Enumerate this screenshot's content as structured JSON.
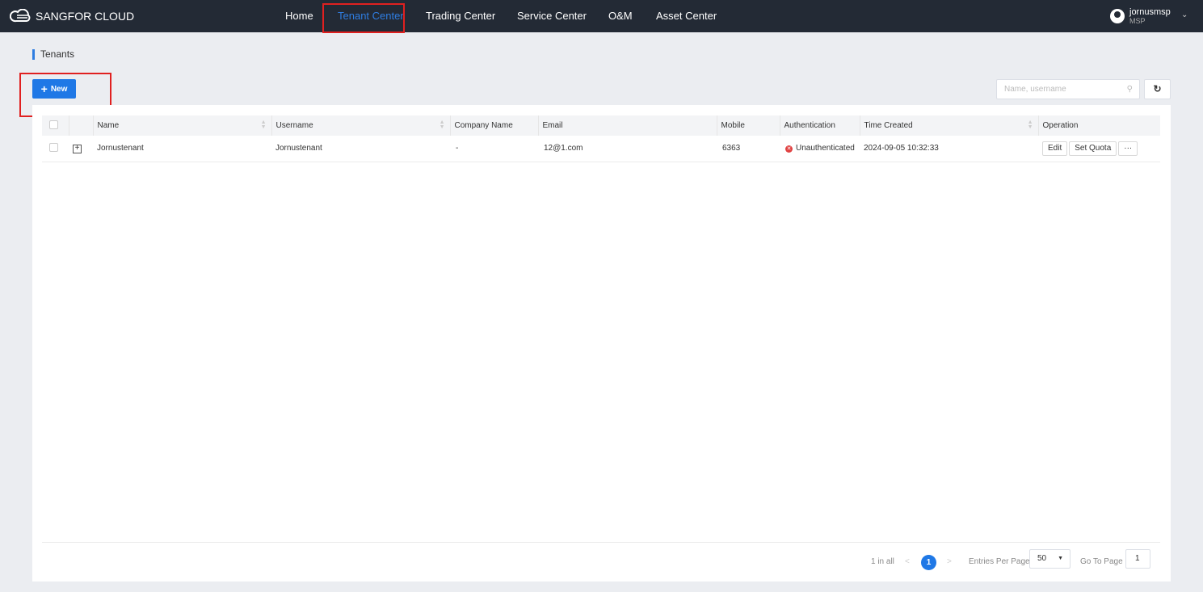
{
  "header": {
    "brand": "SANGFOR CLOUD",
    "nav": [
      "Home",
      "Tenant Center",
      "Trading Center",
      "Service Center",
      "O&M",
      "Asset Center"
    ],
    "active": "Tenant Center",
    "user": {
      "name": "jornusmsp",
      "role": "MSP"
    }
  },
  "page": {
    "title": "Tenants",
    "new_label": "New",
    "search_placeholder": "Name, username"
  },
  "table": {
    "columns": [
      "Name",
      "Username",
      "Company Name",
      "Email",
      "Mobile",
      "Authentication",
      "Time Created",
      "Operation"
    ],
    "rows": [
      {
        "name": "Jornustenant",
        "username": "Jornustenant",
        "company": "-",
        "email": "12@1.com",
        "mobile": "6363",
        "auth": "Unauthenticated",
        "created": "2024-09-05 10:32:33",
        "ops": [
          "Edit",
          "Set Quota",
          "···"
        ]
      }
    ]
  },
  "pagination": {
    "total": "1 in all",
    "current": "1",
    "per_page_label": "Entries Per Page",
    "per_page": "50",
    "goto_label": "Go To Page",
    "goto_value": "1"
  },
  "colors": {
    "accent": "#1f78e6",
    "header_bg": "#232a35",
    "highlight": "#e02020",
    "error": "#e04242"
  }
}
